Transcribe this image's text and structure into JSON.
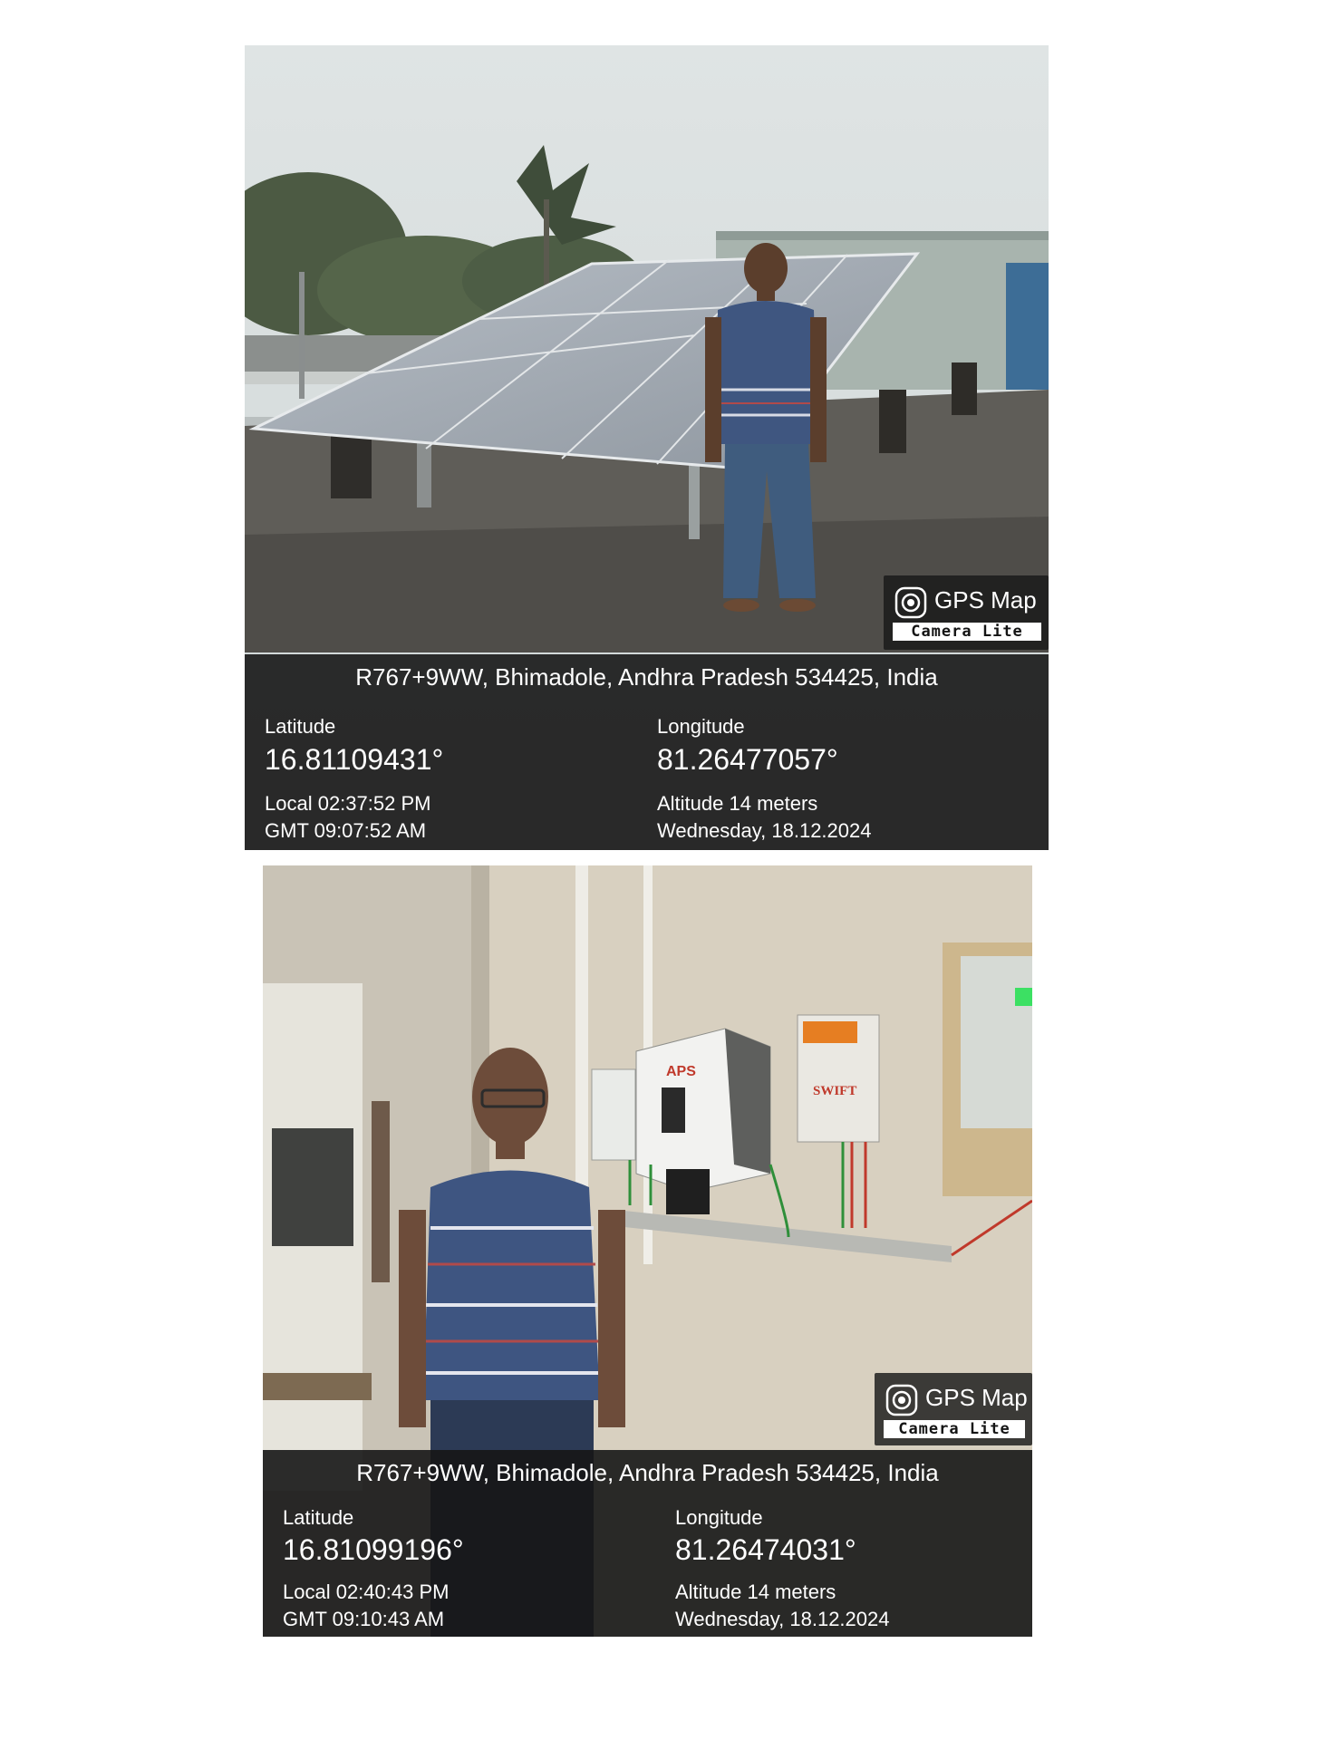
{
  "photos": [
    {
      "badge": {
        "title": "GPS Map",
        "subtitle": "Camera Lite",
        "icon": "camera-icon"
      },
      "address": "R767+9WW, Bhimadole, Andhra Pradesh 534425, India",
      "latitude_label": "Latitude",
      "latitude": "16.81109431°",
      "longitude_label": "Longitude",
      "longitude": "81.26477057°",
      "local_time": "Local 02:37:52 PM",
      "gmt_time": "GMT 09:07:52 AM",
      "altitude": "Altitude 14 meters",
      "date": "Wednesday, 18.12.2024"
    },
    {
      "badge": {
        "title": "GPS Map",
        "subtitle": "Camera Lite",
        "icon": "camera-icon"
      },
      "address": "R767+9WW, Bhimadole, Andhra Pradesh 534425, India",
      "latitude_label": "Latitude",
      "latitude": "16.81099196°",
      "longitude_label": "Longitude",
      "longitude": "81.26474031°",
      "local_time": "Local 02:40:43 PM",
      "gmt_time": "GMT 09:10:43 AM",
      "altitude": "Altitude 14 meters",
      "date": "Wednesday, 18.12.2024"
    }
  ],
  "scene_labels": {
    "inverter_brand": "APS",
    "box_brand": "SWIFT"
  }
}
